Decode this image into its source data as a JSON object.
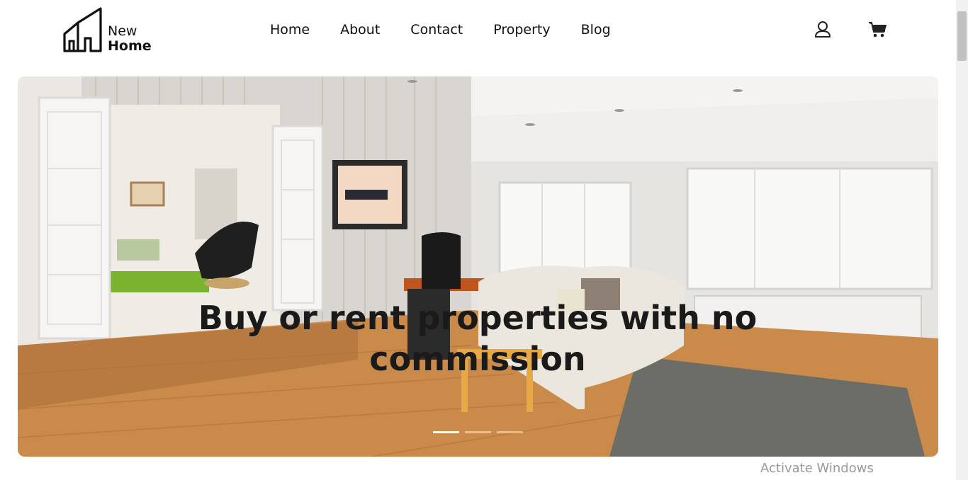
{
  "brand": {
    "line1": "New",
    "line2": "Home"
  },
  "nav": {
    "items": [
      {
        "label": "Home"
      },
      {
        "label": "About"
      },
      {
        "label": "Contact"
      },
      {
        "label": "Property"
      },
      {
        "label": "Blog"
      }
    ]
  },
  "header_icons": {
    "user": "user-icon",
    "cart": "cart-icon"
  },
  "hero": {
    "title": "Buy or rent properties with no commission",
    "slides_total": 3,
    "active_slide": 1
  },
  "watermark": "Activate Windows",
  "colors": {
    "text": "#111111",
    "hero_bg": "#e8e4df",
    "floor": "#c98a4a"
  }
}
